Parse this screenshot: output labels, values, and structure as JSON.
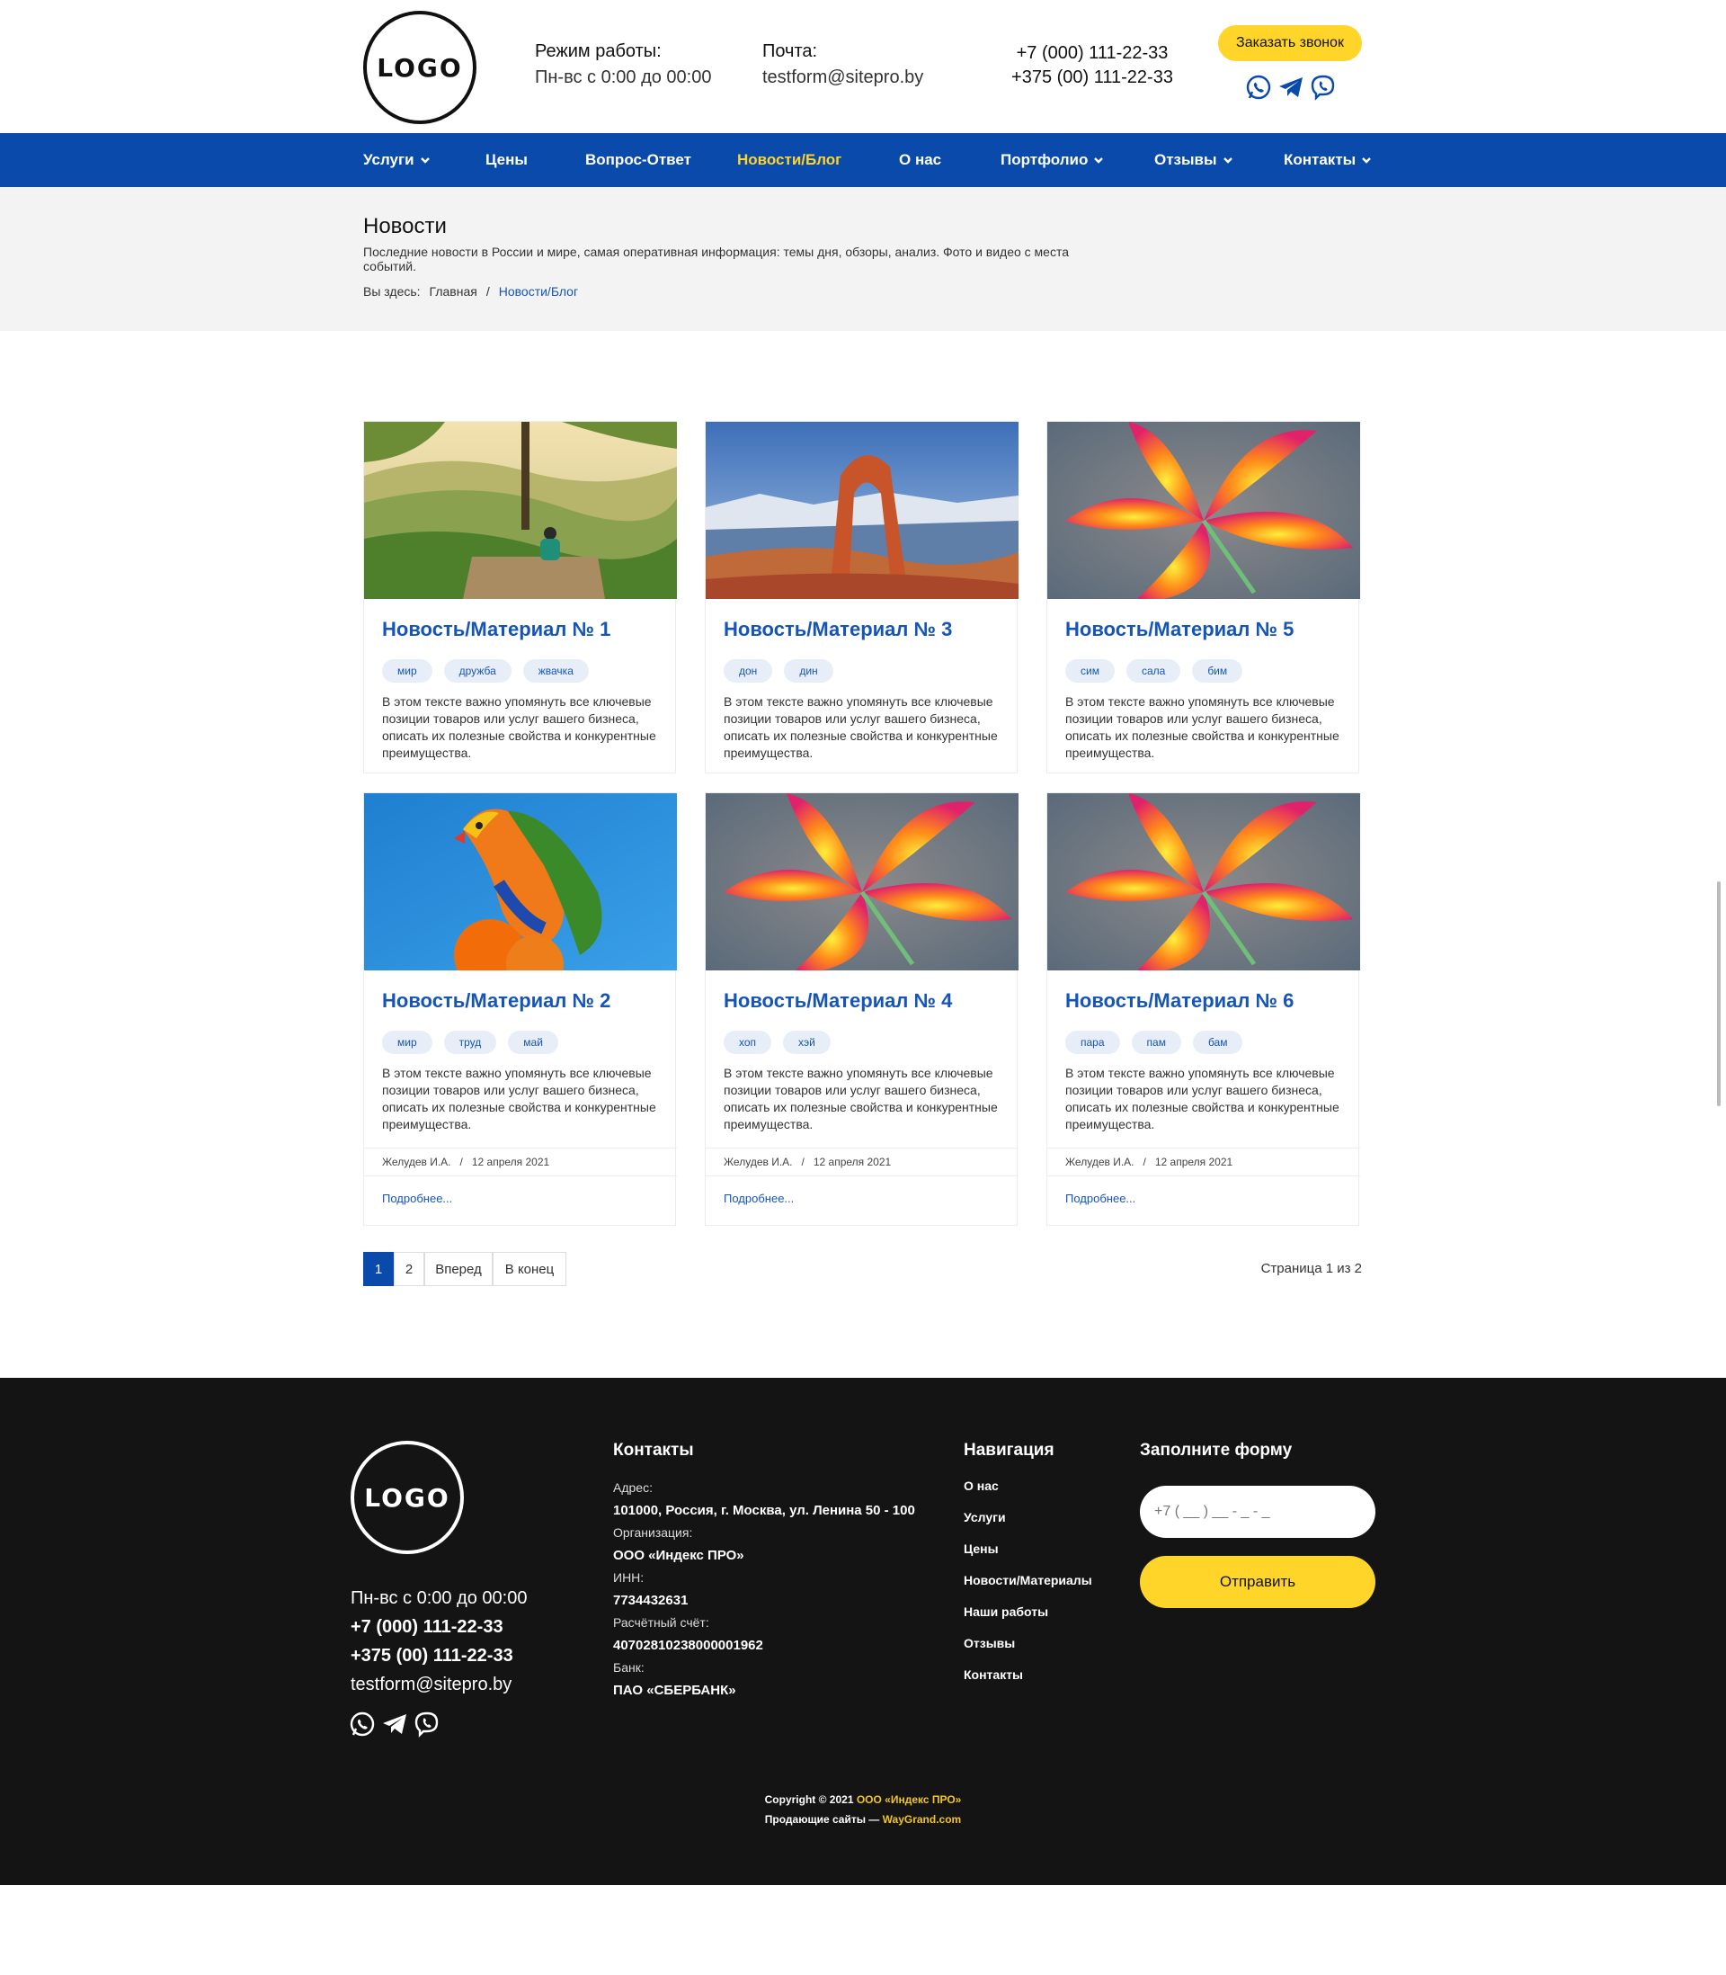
{
  "header": {
    "logo_text": "LOGO",
    "hours_label": "Режим работы:",
    "hours_value": "Пн-вс с 0:00 до 00:00",
    "mail_label": "Почта:",
    "mail_value": "testform@sitepro.by",
    "phone1": "+7 (000) 111-22-33",
    "phone2": "+375 (00) 111-22-33",
    "call_button": "Заказать звонок",
    "social_icons": [
      "whatsapp-icon",
      "telegram-icon",
      "viber-icon"
    ]
  },
  "nav": {
    "items": [
      {
        "label": "Услуги",
        "dropdown": true
      },
      {
        "label": "Цены",
        "dropdown": false
      },
      {
        "label": "Вопрос-Ответ",
        "dropdown": false
      },
      {
        "label": "Новости/Блог",
        "dropdown": false,
        "active": true
      },
      {
        "label": "О нас",
        "dropdown": false
      },
      {
        "label": "Портфолио",
        "dropdown": true
      },
      {
        "label": "Отзывы",
        "dropdown": true
      },
      {
        "label": "Контакты",
        "dropdown": true
      }
    ]
  },
  "banner": {
    "title": "Новости",
    "description": "Последние новости в России и мире, самая оперативная информация: темы дня, обзоры, анализ. Фото и видео с места событий.",
    "breadcrumb_prefix": "Вы здесь:",
    "breadcrumb_home": "Главная",
    "breadcrumb_sep": "/",
    "breadcrumb_current": "Новости/Блог"
  },
  "cards": [
    {
      "title": "Новость/Материал № 1",
      "tags": [
        "мир",
        "дружба",
        "жвачка"
      ],
      "image": "landscape-photo"
    },
    {
      "title": "Новость/Материал № 3",
      "tags": [
        "дон",
        "дин"
      ],
      "image": "arch-photo"
    },
    {
      "title": "Новость/Материал № 5",
      "tags": [
        "сим",
        "сала",
        "бим"
      ],
      "image": "lily-photo"
    },
    {
      "title": "Новость/Материал № 2",
      "tags": [
        "мир",
        "труд",
        "май"
      ],
      "image": "parrot-photo"
    },
    {
      "title": "Новость/Материал № 4",
      "tags": [
        "хоп",
        "хэй"
      ],
      "image": "lily-photo"
    },
    {
      "title": "Новость/Материал № 6",
      "tags": [
        "пара",
        "пам",
        "бам"
      ],
      "image": "lily-photo"
    }
  ],
  "card_text": "В этом тексте важно упомянуть все ключевые позиции товаров или услуг вашего бизнеса, описать их полезные свойства и конкурентные преимущества.",
  "card_meta": {
    "author": "Желудев И.А.",
    "sep": "/",
    "date": "12 апреля 2021",
    "more": "Подробнее..."
  },
  "pagination": {
    "buttons": [
      "1",
      "2",
      "Вперед",
      "В конец"
    ],
    "current": "1",
    "status": "Страница 1 из 2"
  },
  "footer": {
    "logo_text": "LOGO",
    "hours": "Пн-вс с 0:00 до 00:00",
    "phone1": "+7 (000) 111-22-33",
    "phone2": "+375 (00) 111-22-33",
    "email": "testform@sitepro.by",
    "contacts_title": "Контакты",
    "address_label": "Адрес:",
    "address": "101000, Россия, г. Москва, ул. Ленина 50 - 100",
    "org_label": "Организация:",
    "org": "ООО «Индекс ПРО»",
    "inn_label": "ИНН:",
    "inn": "7734432631",
    "account_label": "Расчётный счёт:",
    "account": "40702810238000001962",
    "bank_label": "Банк:",
    "bank": "ПАО «СБЕРБАНК»",
    "nav_title": "Навигация",
    "nav_items": [
      "О нас",
      "Услуги",
      "Цены",
      "Новости/Материалы",
      "Наши работы",
      "Отзывы",
      "Контакты"
    ],
    "form_title": "Заполните форму",
    "phone_placeholder": "+7 ( __ ) __ - _ - _",
    "submit": "Отправить",
    "copyright_prefix": "Copyright © 2021",
    "copyright_company": "ООО «Индекс ПРО»",
    "promo_prefix": "Продающие сайты —",
    "promo_link": "WayGrand.com"
  },
  "colors": {
    "brand_blue": "#0a4aab",
    "accent_yellow": "#ffd52a",
    "footer_bg": "#141414",
    "link_blue": "#1555b8"
  }
}
